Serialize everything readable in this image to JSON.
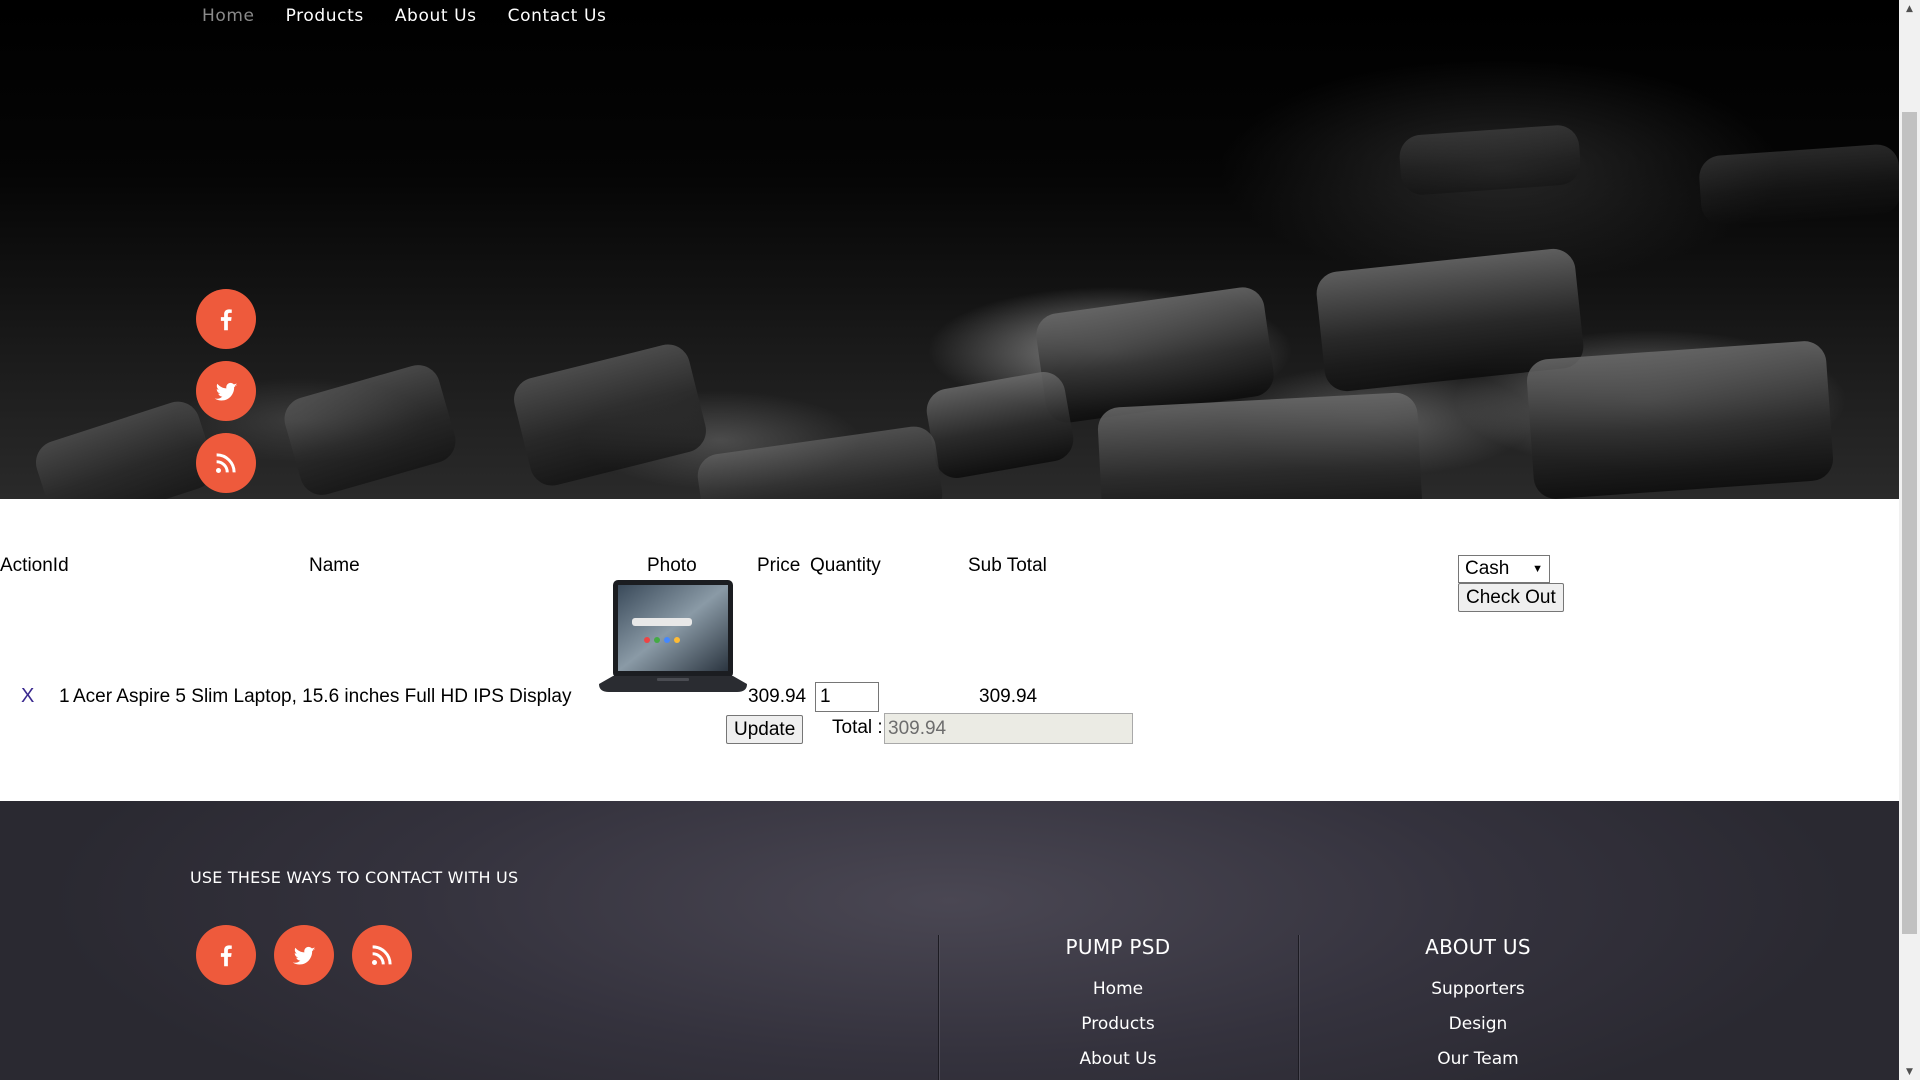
{
  "nav": {
    "items": [
      "Home",
      "Products",
      "About Us",
      "Contact Us"
    ],
    "active": "Home"
  },
  "social_icons": [
    "facebook-icon",
    "twitter-icon",
    "rss-icon"
  ],
  "cart": {
    "headers": {
      "action_id": "ActionId",
      "name": "Name",
      "photo": "Photo",
      "price": "Price",
      "quantity": "Quantity",
      "subtotal": "Sub Total"
    },
    "rows": [
      {
        "remove_label": "X",
        "id": "1",
        "name": "Acer Aspire 5 Slim Laptop, 15.6 inches Full HD IPS Display",
        "price": "309.94",
        "quantity": "1",
        "subtotal": "309.94"
      }
    ],
    "update_label": "Update",
    "total_label": "Total :",
    "total_value": "309.94",
    "payment_method": "Cash",
    "checkout_label": "Check Out"
  },
  "footer": {
    "contact_title": "USE THESE WAYS TO CONTACT WITH US",
    "columns": [
      {
        "title": "PUMP PSD",
        "links": [
          "Home",
          "Products",
          "About Us"
        ]
      },
      {
        "title": "ABOUT US",
        "links": [
          "Supporters",
          "Design",
          "Our Team"
        ]
      }
    ]
  },
  "colors": {
    "social_accent": "#ee5a3c",
    "footer_bg": "#34323d",
    "remove_link": "#3b2a8f"
  }
}
